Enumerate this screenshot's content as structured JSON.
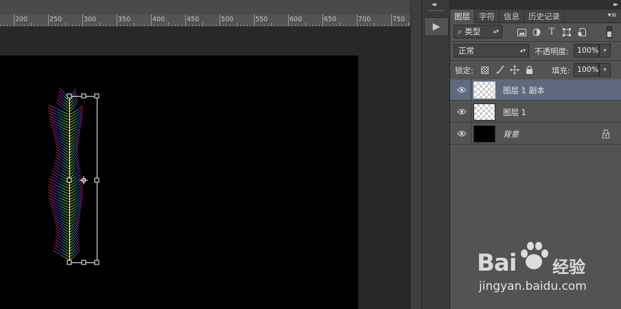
{
  "ruler": {
    "labels": [
      "200",
      "250",
      "300",
      "350",
      "400",
      "450",
      "500",
      "550",
      "600",
      "650",
      "700",
      "750"
    ]
  },
  "panel": {
    "tabs": [
      {
        "label": "图层",
        "active": true
      },
      {
        "label": "字符",
        "active": false
      },
      {
        "label": "信息",
        "active": false
      },
      {
        "label": "历史记录",
        "active": false
      }
    ],
    "filter": {
      "label": "类型",
      "icons": [
        "image-filter-icon",
        "adjustment-filter-icon",
        "type-filter-icon",
        "shape-filter-icon",
        "smart-object-filter-icon"
      ]
    },
    "blend_mode": "正常",
    "opacity_label": "不透明度:",
    "opacity_value": "100%",
    "lock_label": "锁定:",
    "fill_label": "填充:",
    "fill_value": "100%"
  },
  "layers": [
    {
      "name": "图层 1 副本",
      "selected": true,
      "thumb": "transparent",
      "locked": false
    },
    {
      "name": "图层 1",
      "selected": false,
      "thumb": "transparent",
      "locked": false
    },
    {
      "name": "背景",
      "selected": false,
      "thumb": "black",
      "locked": true
    }
  ],
  "watermark": {
    "brand": "Bai",
    "cn": "经验",
    "url": "jingyan.baidu.com"
  },
  "colors": {
    "selected_layer": "#5e6b7e",
    "panel_bg": "#535353",
    "canvas_bg": "#000000"
  }
}
